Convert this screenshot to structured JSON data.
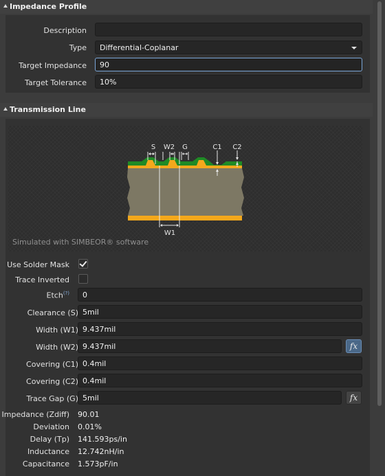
{
  "impedance_profile": {
    "header": "Impedance Profile",
    "description_label": "Description",
    "description_value": "",
    "type_label": "Type",
    "type_value": "Differential-Coplanar",
    "target_impedance_label": "Target Impedance",
    "target_impedance_value": "90",
    "target_tolerance_label": "Target Tolerance",
    "target_tolerance_value": "10%"
  },
  "transmission_line": {
    "header": "Transmission Line",
    "diagram": {
      "labels": {
        "s": "S",
        "w2": "W2",
        "g": "G",
        "c1": "C1",
        "c2": "C2",
        "w1": "W1"
      },
      "caption": "Simulated with SIMBEOR® software",
      "colors": {
        "copper": "#f4a81c",
        "mask": "#1f8a25",
        "dielectric": "#7d7864",
        "background": "#2e2e2e"
      }
    },
    "use_solder_mask": {
      "label": "Use Solder Mask",
      "checked": true
    },
    "trace_inverted": {
      "label": "Trace Inverted",
      "checked": false
    },
    "etch": {
      "label": "Etch",
      "help": "(?)",
      "value": "0"
    },
    "clearance": {
      "label": "Clearance (S)",
      "value": "5mil"
    },
    "width_w1": {
      "label": "Width (W1)",
      "value": "9.437mil"
    },
    "width_w2": {
      "label": "Width (W2)",
      "value": "9.437mil"
    },
    "covering_c1": {
      "label": "Covering (C1)",
      "value": "0.4mil"
    },
    "covering_c2": {
      "label": "Covering (C2)",
      "value": "0.4mil"
    },
    "trace_gap": {
      "label": "Trace Gap (G)",
      "value": "5mil"
    },
    "fx_label": "fx",
    "results": [
      {
        "label": "Impedance (Zdiff)",
        "value": "90.01"
      },
      {
        "label": "Deviation",
        "value": "0.01%"
      },
      {
        "label": "Delay (Tp)",
        "value": "141.593ps/in"
      },
      {
        "label": "Inductance",
        "value": "12.742nH/in"
      },
      {
        "label": "Capacitance",
        "value": "1.573pF/in"
      }
    ]
  }
}
